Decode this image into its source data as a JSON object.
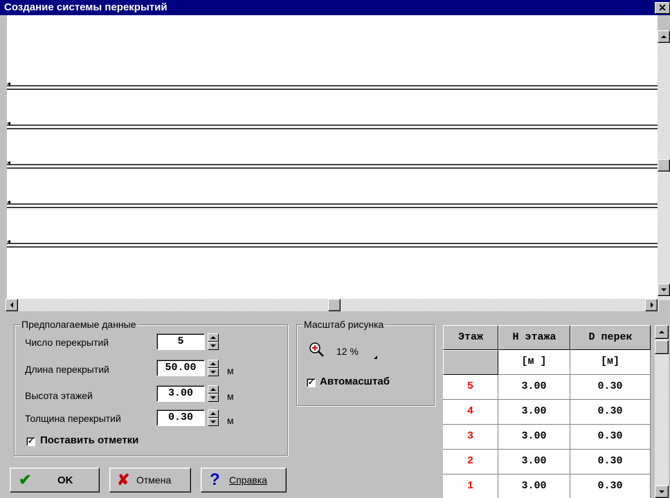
{
  "window": {
    "title": "Создание системы перекрытий",
    "close_label": "✕"
  },
  "preview": {
    "floor_count": 5
  },
  "assumed_data": {
    "legend": "Предполагаемые данные",
    "fields": [
      {
        "label": "Число перекрытий",
        "value": "5",
        "unit": ""
      },
      {
        "label": "Длина перекрытий",
        "value": "50.00",
        "unit": "м"
      },
      {
        "label": "Высота этажей",
        "value": "3.00",
        "unit": "м"
      },
      {
        "label": "Толщина перекрытий",
        "value": "0.30",
        "unit": "м"
      }
    ],
    "marks_checkbox": {
      "label": "Поставить отметки",
      "checked": true,
      "mark": "✓"
    }
  },
  "scale": {
    "legend": "Масштаб рисунка",
    "zoom_icon": "zoom-in-icon",
    "zoom_value": "12 %",
    "auto_checkbox": {
      "label": "Автомасштаб",
      "checked": true,
      "mark": "✓"
    }
  },
  "buttons": {
    "ok": {
      "icon": "✔",
      "label": "OK"
    },
    "cancel": {
      "icon": "✘",
      "label": "Отмена"
    },
    "help": {
      "icon": "?",
      "label": "Справка"
    }
  },
  "table": {
    "headers": [
      "Этаж",
      "Н этажа",
      "D перек"
    ],
    "units": [
      "",
      "[м ]",
      "[м]"
    ],
    "rows": [
      {
        "floor": "5",
        "height": "3.00",
        "thickness": "0.30"
      },
      {
        "floor": "4",
        "height": "3.00",
        "thickness": "0.30"
      },
      {
        "floor": "3",
        "height": "3.00",
        "thickness": "0.30"
      },
      {
        "floor": "2",
        "height": "3.00",
        "thickness": "0.30"
      },
      {
        "floor": "1",
        "height": "3.00",
        "thickness": "0.30"
      }
    ]
  },
  "colors": {
    "titlebar": "#000080",
    "floor_number": "#ff0000",
    "ok_icon": "#008000",
    "cancel_icon": "#cc0000",
    "help_icon": "#0000cc"
  }
}
